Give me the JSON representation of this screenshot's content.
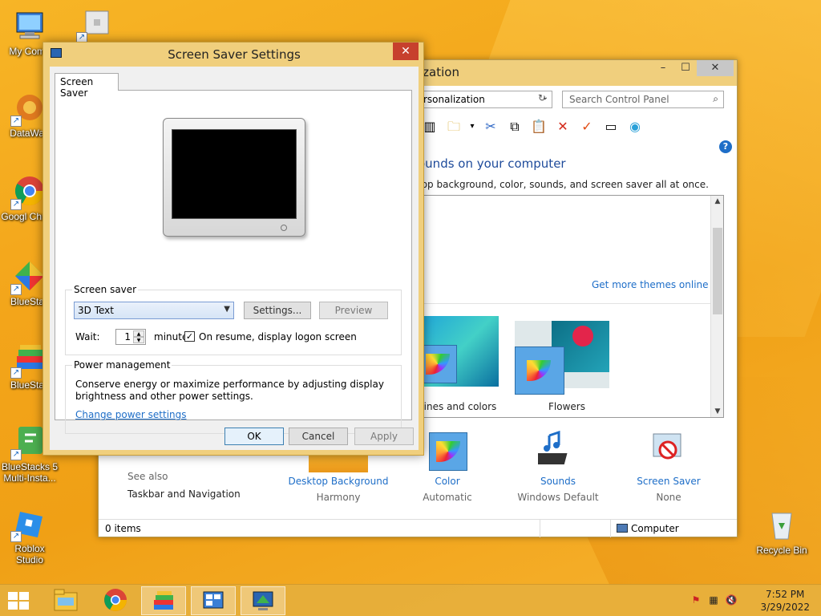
{
  "desktop": {
    "icons": [
      {
        "label": "My Comp",
        "icon": "computer-icon"
      },
      {
        "label": "",
        "icon": "roblox-shortcut-icon"
      },
      {
        "label": "DataWag",
        "icon": "datawag-icon"
      },
      {
        "label": "Googl Chrom",
        "icon": "chrome-icon"
      },
      {
        "label": "BlueStac",
        "icon": "bluestacks-icon"
      },
      {
        "label": "BlueStac",
        "icon": "bluestacks-x-icon"
      },
      {
        "label": "BlueStacks 5 Multi-Insta...",
        "icon": "bluestacks-multi-icon"
      },
      {
        "label": "Roblox Studio",
        "icon": "roblox-studio-icon"
      },
      {
        "label": "Recycle Bin",
        "icon": "recycle-bin-icon"
      }
    ]
  },
  "control_panel": {
    "title": "ization",
    "address": "rsonalization",
    "search_placeholder": "Search Control Panel",
    "heading": "ounds on your computer",
    "subheading": "top background, color, sounds, and screen saver all at once.",
    "get_more": "Get more themes online",
    "themes": [
      {
        "label": "Lines and colors"
      },
      {
        "label": "Flowers"
      }
    ],
    "see_also": "See also",
    "see_also_link": "Taskbar and Navigation",
    "bottom_items": [
      {
        "label": "Desktop Background",
        "value": "Harmony"
      },
      {
        "label": "Color",
        "value": "Automatic"
      },
      {
        "label": "Sounds",
        "value": "Windows Default"
      },
      {
        "label": "Screen Saver",
        "value": "None"
      }
    ],
    "status_items": "0 items",
    "status_computer": "Computer"
  },
  "dialog": {
    "title": "Screen Saver Settings",
    "tab": "Screen Saver",
    "screen_saver_group": "Screen saver",
    "selected_saver": "3D Text",
    "settings_btn": "Settings...",
    "preview_btn": "Preview",
    "wait_label": "Wait:",
    "wait_value": "1",
    "minutes_label": "minutes",
    "resume_label": "On resume, display logon screen",
    "resume_checked": true,
    "power_group": "Power management",
    "power_text_1": "Conserve energy or maximize performance by adjusting display",
    "power_text_2": "brightness and other power settings.",
    "power_link": "Change power settings",
    "ok": "OK",
    "cancel": "Cancel",
    "apply": "Apply"
  },
  "taskbar": {
    "time": "7:52 PM",
    "date": "3/29/2022"
  },
  "colors": {
    "dialog_frame": "#f0cf7d",
    "close_red": "#c7402d",
    "link_blue": "#1e6ec8"
  }
}
